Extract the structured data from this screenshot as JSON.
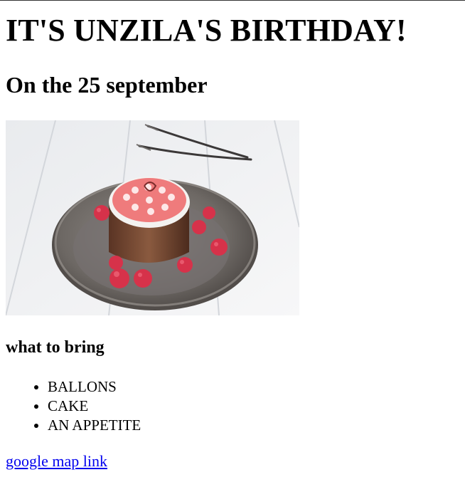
{
  "title": "IT'S UNZILA'S BIRTHDAY!",
  "date_heading": "On the 25 september",
  "image": {
    "icon": "cake-photo"
  },
  "bring_heading": "what to bring",
  "bring_items": [
    "BALLONS",
    "CAKE",
    "AN APPETITE"
  ],
  "map_link": "google map link",
  "colors": {
    "link": "#0000ee",
    "text": "#000000",
    "background": "#ffffff"
  }
}
